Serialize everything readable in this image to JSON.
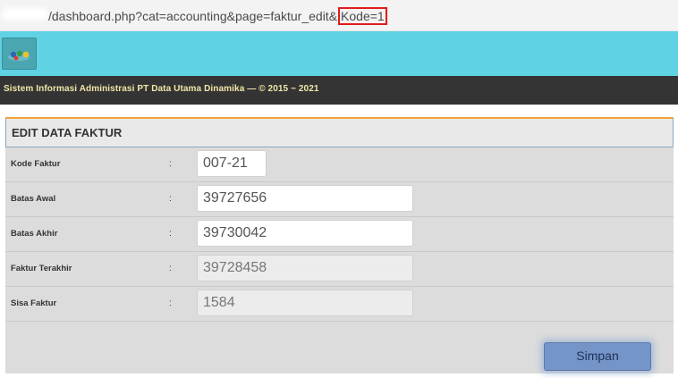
{
  "address_bar": {
    "url_main": "/dashboard.php?cat=accounting&page=faktur_edit&",
    "url_highlight": "Kode=1"
  },
  "header": {
    "logo_icon": "app-logo-icon",
    "subtitle": "Sistem Informasi Administrasi PT Data Utama Dinamika  —  © 2015 ~ 2021"
  },
  "form": {
    "title": "EDIT DATA FAKTUR",
    "colon": ":",
    "fields": [
      {
        "label": "Kode Faktur",
        "value": "007-21",
        "readonly": false
      },
      {
        "label": "Batas Awal",
        "value": "39727656",
        "readonly": false
      },
      {
        "label": "Batas Akhir",
        "value": "39730042",
        "readonly": false
      },
      {
        "label": "Faktur Terakhir",
        "value": "39728458",
        "readonly": true
      },
      {
        "label": "Sisa Faktur",
        "value": "1584",
        "readonly": true
      }
    ],
    "submit_label": "Simpan"
  },
  "colors": {
    "header_bg": "#5fd3e3",
    "subbar_bg": "#343434",
    "highlight_border": "#e21b1b",
    "button_bg": "#7595c9"
  }
}
